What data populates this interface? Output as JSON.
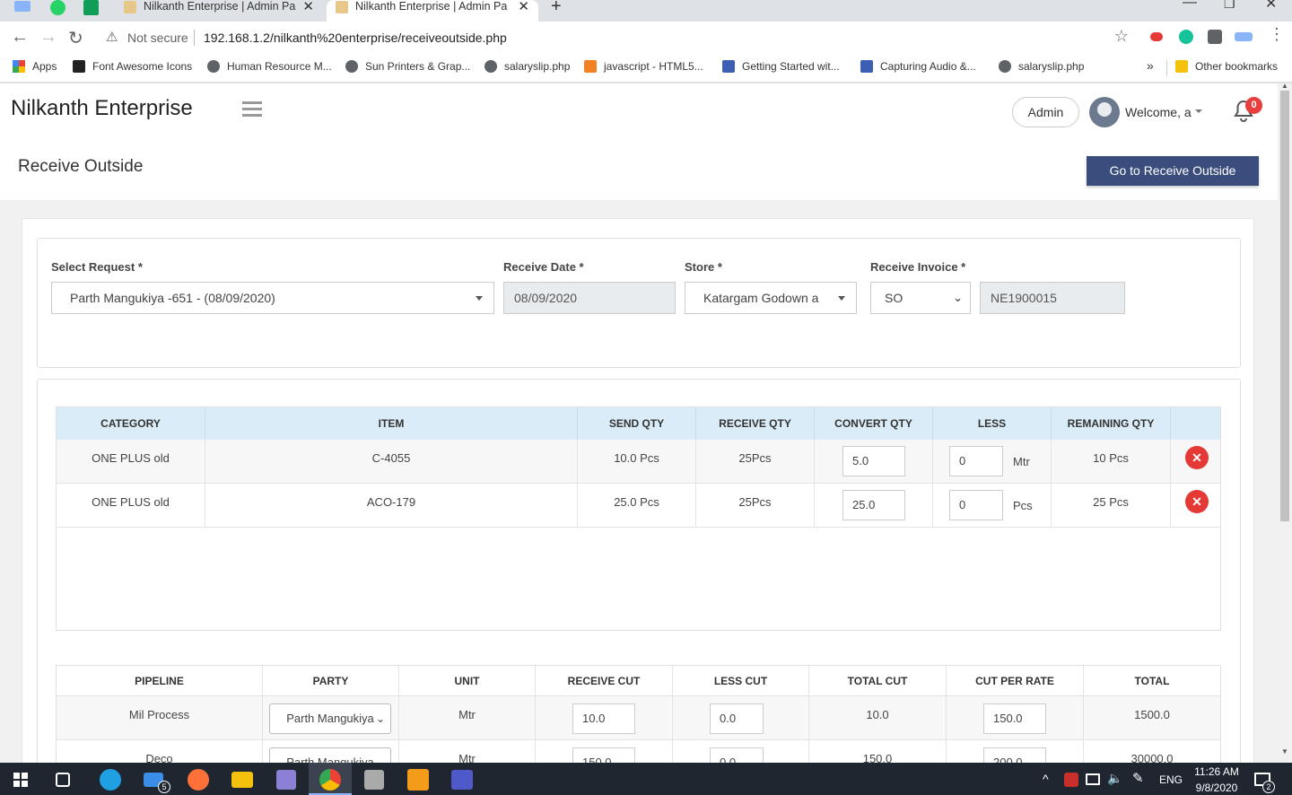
{
  "browser": {
    "tabs": [
      {
        "title": "Nilkanth Enterprise | Admin Panel",
        "active": false
      },
      {
        "title": "Nilkanth Enterprise | Admin Panel",
        "active": true
      }
    ],
    "security": "Not secure",
    "url": "192.168.1.2/nilkanth%20enterprise/receiveoutside.php",
    "bookmarks": [
      "Apps",
      "Font Awesome Icons",
      "Human Resource M...",
      "Sun Printers & Grap...",
      "salaryslip.php",
      "javascript - HTML5...",
      "Getting Started wit...",
      "Capturing Audio &...",
      "salaryslip.php"
    ],
    "bookmarks_more": "»",
    "other_bookmarks": "Other bookmarks"
  },
  "header": {
    "brand": "Nilkanth Enterprise",
    "role_button": "Admin",
    "welcome": "Welcome, a",
    "notification_count": "0"
  },
  "page": {
    "title": "Receive Outside",
    "go_button": "Go to Receive Outside"
  },
  "form": {
    "request_label": "Select Request *",
    "request_value": "Parth Mangukiya -651 - (08/09/2020)",
    "date_label": "Receive Date *",
    "date_value": "08/09/2020",
    "store_label": "Store *",
    "store_value": "Katargam Godown a",
    "invoice_label": "Receive Invoice *",
    "invoice_prefix": "SO",
    "invoice_number": "NE1900015"
  },
  "items_table": {
    "headers": [
      "CATEGORY",
      "ITEM",
      "SEND QTY",
      "RECEIVE QTY",
      "CONVERT QTY",
      "LESS",
      "REMAINING QTY"
    ],
    "rows": [
      {
        "category": "ONE PLUS old",
        "item": "C-4055",
        "send_qty": "10.0 Pcs",
        "receive_qty": "25Pcs",
        "convert_qty": "5.0",
        "less": "0",
        "less_unit": "Mtr",
        "remaining": "10 Pcs"
      },
      {
        "category": "ONE PLUS old",
        "item": "ACO-179",
        "send_qty": "25.0 Pcs",
        "receive_qty": "25Pcs",
        "convert_qty": "25.0",
        "less": "0",
        "less_unit": "Pcs",
        "remaining": "25 Pcs"
      }
    ]
  },
  "pipeline_table": {
    "headers": [
      "PIPELINE",
      "PARTY",
      "UNIT",
      "RECEIVE CUT",
      "LESS CUT",
      "TOTAL CUT",
      "CUT PER RATE",
      "TOTAL"
    ],
    "rows": [
      {
        "pipeline": "Mil Process",
        "party": "Parth Mangukiya",
        "unit": "Mtr",
        "receive_cut": "10.0",
        "less_cut": "0.0",
        "total_cut": "10.0",
        "cut_per_rate": "150.0",
        "total": "1500.0"
      },
      {
        "pipeline": "Deco",
        "party": "Parth Mangukiya",
        "unit": "Mtr",
        "receive_cut": "150.0",
        "less_cut": "0.0",
        "total_cut": "150.0",
        "cut_per_rate": "200.0",
        "total": "30000.0"
      }
    ]
  },
  "taskbar": {
    "mail_badge": "5",
    "language": "ENG",
    "time": "11:26 AM",
    "date": "9/8/2020",
    "notification_badge": "2"
  },
  "colors": {
    "primary_button": "#3a4d7d",
    "table_header": "#d9ecf7",
    "delete": "#e53935",
    "badge": "#e83e3e"
  }
}
